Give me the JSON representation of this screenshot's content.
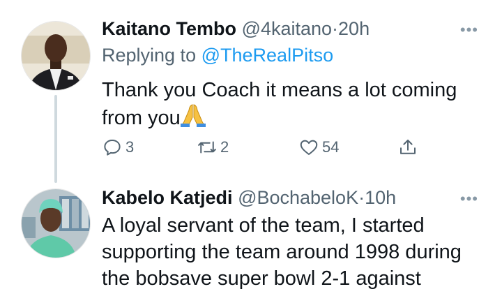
{
  "tweets": [
    {
      "name": "Kaitano Tembo",
      "handle": "@4kaitano",
      "time": "20h",
      "replying_label": "Replying to",
      "replying_to": "@TheRealPitso",
      "text_line1": "Thank you Coach it means a lot coming",
      "text_line2": "from you",
      "emoji": "folded-hands",
      "replies": "3",
      "retweets": "2",
      "likes": "54"
    },
    {
      "name": "Kabelo Katjedi",
      "handle": "@BochabeloK",
      "time": "10h",
      "text_line1": "A loyal servant of the team, I started",
      "text_line2": "supporting the team around 1998 during",
      "text_line3": "the bobsave super bowl 2-1 against"
    }
  ],
  "ui": {
    "separator": "·",
    "more": "•••"
  },
  "colors": {
    "accent": "#1d9bf0",
    "secondary": "#536471"
  }
}
